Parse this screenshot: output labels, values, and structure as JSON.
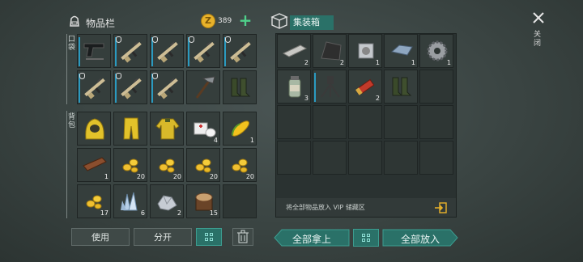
{
  "inventory": {
    "title": "物品栏",
    "coin_count": "389",
    "pocket_label": "口袋",
    "backpack_label": "背包",
    "pocket_items": [
      {
        "icon": "pistol-icon",
        "qty": "",
        "badge": false
      },
      {
        "icon": "rifle-icon",
        "qty": "",
        "badge": true
      },
      {
        "icon": "rifle-icon",
        "qty": "",
        "badge": true
      },
      {
        "icon": "rifle-icon",
        "qty": "",
        "badge": true
      },
      {
        "icon": "rifle-icon",
        "qty": "",
        "badge": true
      },
      {
        "icon": "rifle-icon",
        "qty": "",
        "badge": true
      },
      {
        "icon": "rifle-icon",
        "qty": "",
        "badge": true
      },
      {
        "icon": "rifle-icon",
        "qty": "",
        "badge": true
      },
      {
        "icon": "axe-hammer-icon",
        "qty": "",
        "badge": false
      },
      {
        "icon": "boots-icon",
        "qty": "",
        "badge": false
      }
    ],
    "backpack_items": [
      {
        "icon": "hazmat-helmet-icon",
        "qty": ""
      },
      {
        "icon": "hazmat-pants-icon",
        "qty": ""
      },
      {
        "icon": "hazmat-jacket-icon",
        "qty": ""
      },
      {
        "icon": "bandage-icon",
        "qty": "4"
      },
      {
        "icon": "corn-icon",
        "qty": "1"
      },
      {
        "icon": "plank-icon",
        "qty": "1"
      },
      {
        "icon": "seeds-icon",
        "qty": "20"
      },
      {
        "icon": "seeds-icon",
        "qty": "20"
      },
      {
        "icon": "seeds-icon",
        "qty": "20"
      },
      {
        "icon": "seeds-icon",
        "qty": "20"
      },
      {
        "icon": "seeds-icon",
        "qty": "17"
      },
      {
        "icon": "crystal-icon",
        "qty": "6"
      },
      {
        "icon": "metal-ore-icon",
        "qty": "2"
      },
      {
        "icon": "log-icon",
        "qty": "15"
      },
      {
        "icon": "empty",
        "qty": ""
      }
    ],
    "use_label": "使用",
    "split_label": "分开"
  },
  "container": {
    "title": "集装箱",
    "items": [
      {
        "icon": "metal-bar-icon",
        "qty": "2"
      },
      {
        "icon": "metal-sheet-icon",
        "qty": "2"
      },
      {
        "icon": "engine-part-icon",
        "qty": "1"
      },
      {
        "icon": "steel-ingot-icon",
        "qty": "1"
      },
      {
        "icon": "gear-icon",
        "qty": "1"
      },
      {
        "icon": "jar-icon",
        "qty": "3"
      },
      {
        "icon": "tripod-icon",
        "qty": ""
      },
      {
        "icon": "shells-icon",
        "qty": "2"
      },
      {
        "icon": "boots-icon",
        "qty": ""
      }
    ],
    "vip_text": "将全部物品放入 VIP 储藏区",
    "take_all_label": "全部拿上",
    "put_all_label": "全部放入"
  },
  "close_label": "关闭",
  "colors": {
    "accent": "#2a7168",
    "coin": "#e8b22a",
    "plus": "#4fd08a"
  }
}
